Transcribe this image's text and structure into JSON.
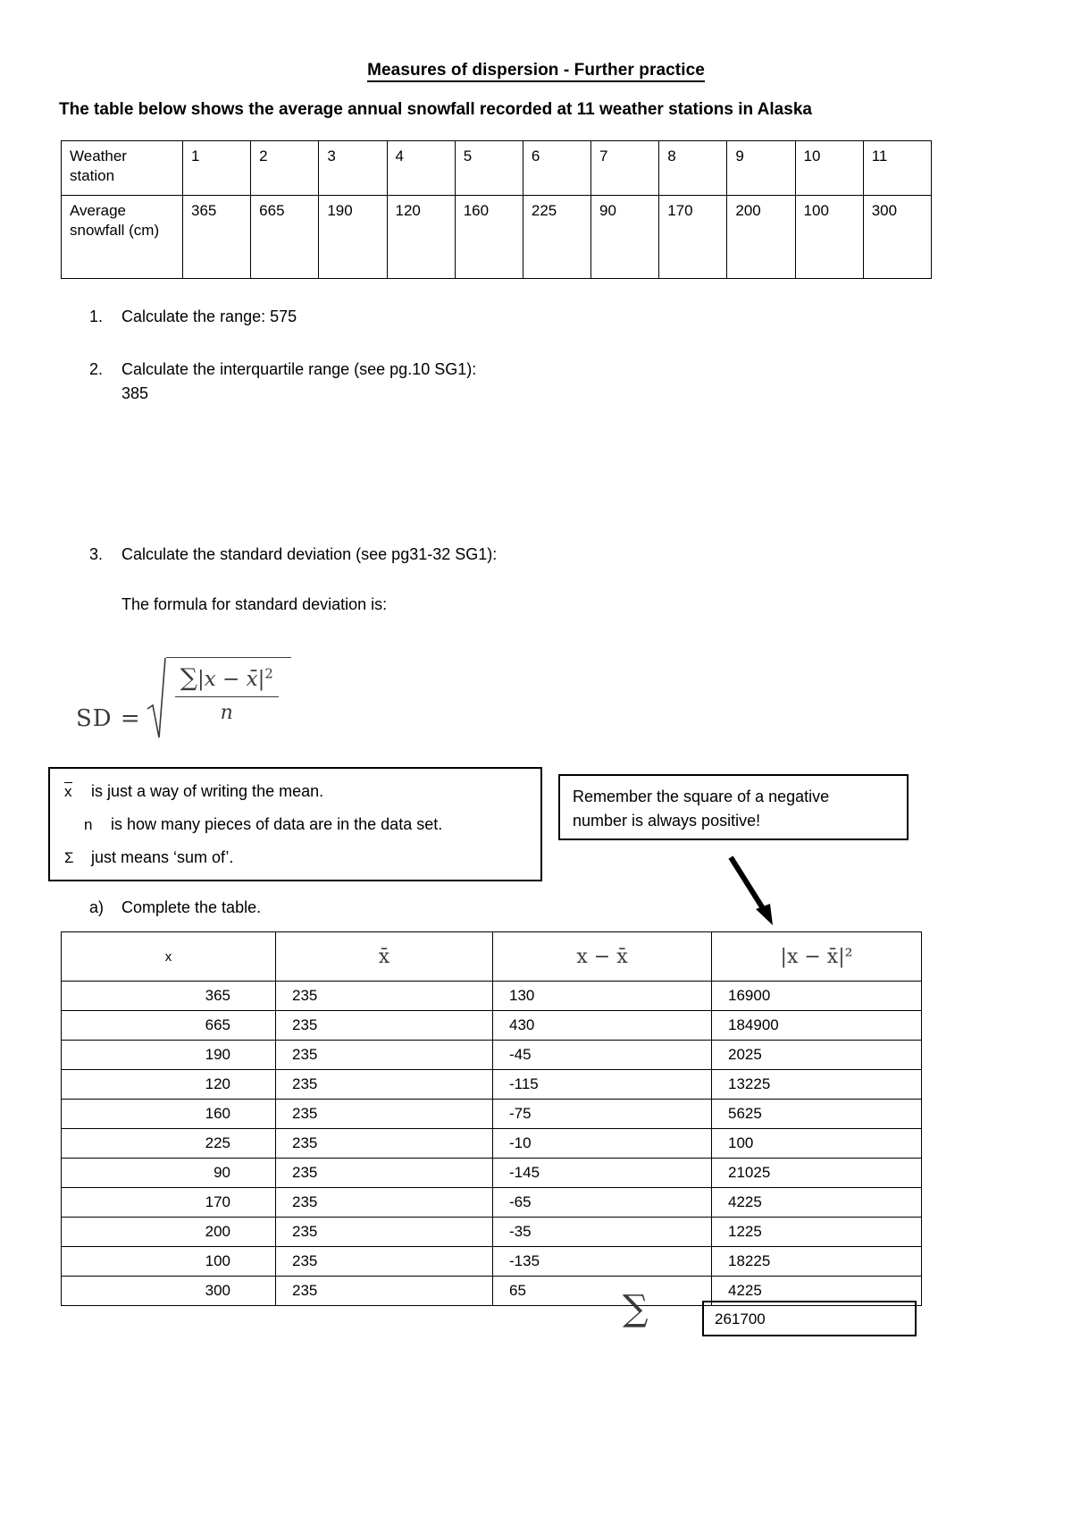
{
  "document": {
    "title": "Measures of dispersion - Further practice",
    "intro": "The table below shows the average annual snowfall recorded at 11 weather stations in Alaska"
  },
  "station_table": {
    "row_labels": [
      "Weather station",
      "Average snowfall (cm)"
    ],
    "stations": [
      "1",
      "2",
      "3",
      "4",
      "5",
      "6",
      "7",
      "8",
      "9",
      "10",
      "11"
    ],
    "snowfall": [
      "365",
      "665",
      "190",
      "120",
      "160",
      "225",
      "90",
      "170",
      "200",
      "100",
      "300"
    ]
  },
  "questions": [
    {
      "num": "1.",
      "text": "Calculate the range: 575",
      "answer": "575"
    },
    {
      "num": "2.",
      "text": "Calculate the interquartile range (see pg.10 SG1):",
      "answer": "385"
    },
    {
      "num": "3.",
      "text": "Calculate the standard deviation (see pg31-32 SG1):",
      "answer": ""
    }
  ],
  "formula": {
    "intro": "The formula for standard deviation is:",
    "lhs": "SD =",
    "numerator_sum": "∑",
    "numerator_body": "|x − x̄|",
    "numerator_exponent": "2",
    "denominator": "n",
    "plain": "SD = sqrt( ∑ |x - x̄|² / n )"
  },
  "notes": {
    "left": [
      {
        "symbol": "x̄",
        "text": "is just a way of writing the mean."
      },
      {
        "symbol": "n",
        "text": "is how many pieces of data are in the data set."
      },
      {
        "symbol": "Σ",
        "text": "just means ‘sum of’."
      }
    ],
    "right": {
      "line1": "Remember the square of a negative",
      "line2": "number is always positive!"
    }
  },
  "item_a": {
    "num": "a)",
    "text": "Complete the table."
  },
  "work_table": {
    "headers": [
      "x",
      "x̄",
      "x − x̄",
      "|x − x̄|²"
    ],
    "rows": [
      {
        "x": "365",
        "mean": "235",
        "dev": "130",
        "sq": "16900"
      },
      {
        "x": "665",
        "mean": "235",
        "dev": "430",
        "sq": "184900"
      },
      {
        "x": "190",
        "mean": "235",
        "dev": "-45",
        "sq": "2025"
      },
      {
        "x": "120",
        "mean": "235",
        "dev": "-115",
        "sq": "13225"
      },
      {
        "x": "160",
        "mean": "235",
        "dev": "-75",
        "sq": "5625"
      },
      {
        "x": "225",
        "mean": "235",
        "dev": "-10",
        "sq": "100"
      },
      {
        "x": "90",
        "mean": "235",
        "dev": "-145",
        "sq": "21025"
      },
      {
        "x": "170",
        "mean": "235",
        "dev": "-65",
        "sq": "4225"
      },
      {
        "x": "200",
        "mean": "235",
        "dev": "-35",
        "sq": "1225"
      },
      {
        "x": "100",
        "mean": "235",
        "dev": "-135",
        "sq": "18225"
      },
      {
        "x": "300",
        "mean": "235",
        "dev": "65",
        "sq": "4225"
      }
    ]
  },
  "sum_row": {
    "sigma": "∑",
    "total": "261700"
  },
  "colors": {
    "text": "#000000",
    "math": "#3a3a3a",
    "border": "#000000",
    "background": "#ffffff"
  }
}
